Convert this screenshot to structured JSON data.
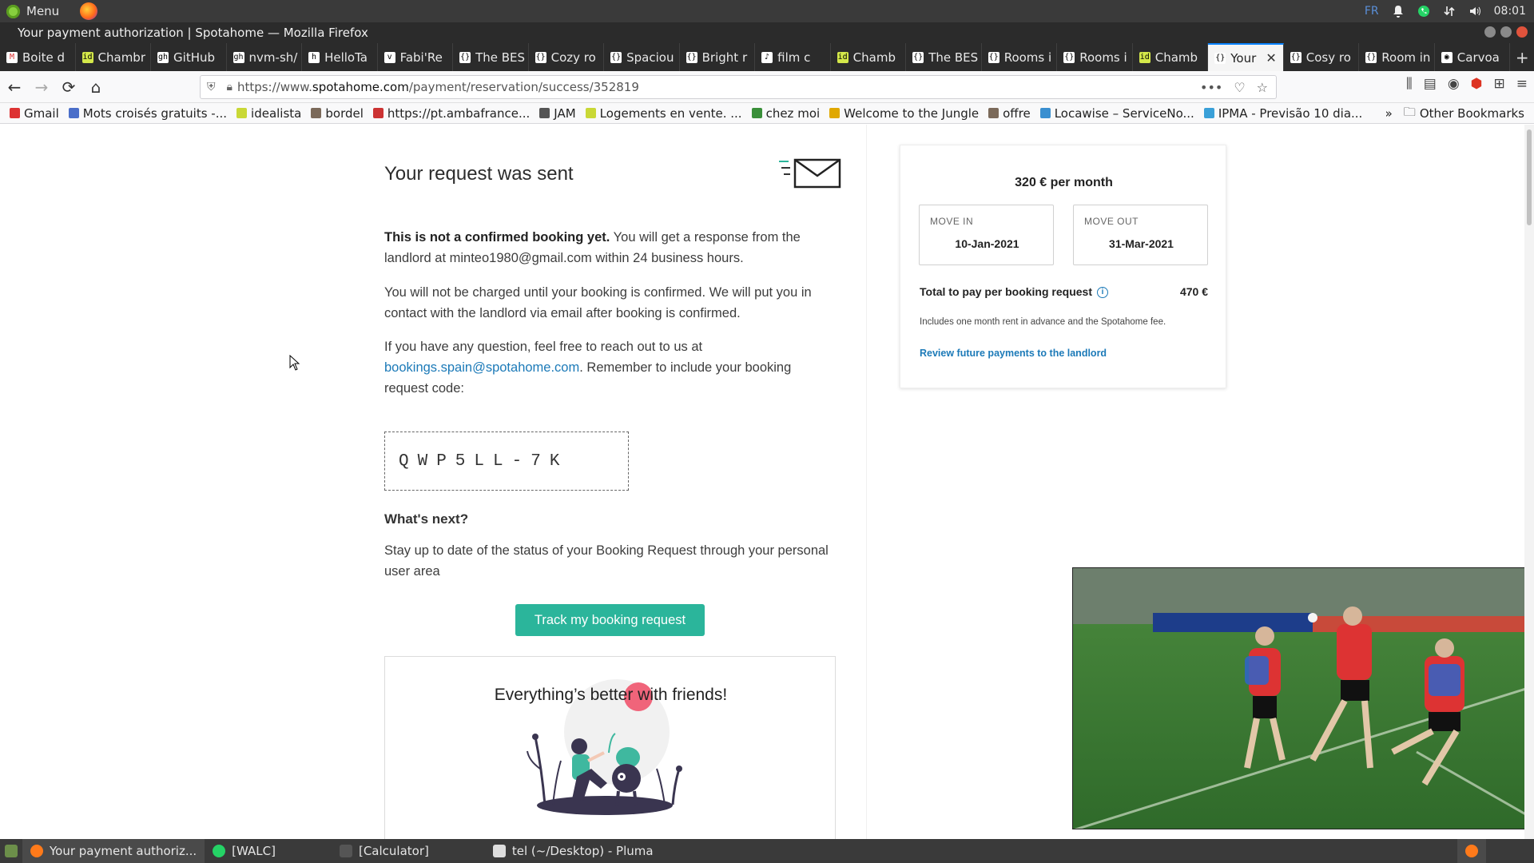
{
  "panel": {
    "menu_label": "Menu",
    "lang": "FR",
    "time": "08:01"
  },
  "window": {
    "title": "Your payment authorization | Spotahome — Mozilla Firefox"
  },
  "tabs": [
    {
      "label": "Boite d",
      "fav": "M"
    },
    {
      "label": "Chambr",
      "fav": "id"
    },
    {
      "label": "GitHub",
      "fav": "gh"
    },
    {
      "label": "nvm-sh/",
      "fav": "gh"
    },
    {
      "label": "HelloTa",
      "fav": "h"
    },
    {
      "label": "Fabi'Re",
      "fav": "v"
    },
    {
      "label": "The BES",
      "fav": "{}"
    },
    {
      "label": "Cozy ro",
      "fav": "{}"
    },
    {
      "label": "Spaciou",
      "fav": "{}"
    },
    {
      "label": "Bright r",
      "fav": "{}"
    },
    {
      "label": "film c",
      "fav": "♪"
    },
    {
      "label": "Chamb",
      "fav": "id"
    },
    {
      "label": "The BES",
      "fav": "{}"
    },
    {
      "label": "Rooms i",
      "fav": "{}"
    },
    {
      "label": "Rooms i",
      "fav": "{}"
    },
    {
      "label": "Chamb",
      "fav": "id"
    },
    {
      "label": "Your",
      "fav": "{}"
    },
    {
      "label": "Cosy ro",
      "fav": "{}"
    },
    {
      "label": "Room in",
      "fav": "{}"
    },
    {
      "label": "Carvoa",
      "fav": "◉"
    }
  ],
  "url": {
    "prefix": "https://www.",
    "host": "spotahome.com",
    "path": "/payment/reservation/success/352819"
  },
  "bookmarks": [
    "Gmail",
    "Mots croisés gratuits -...",
    "idealista",
    "bordel",
    "https://pt.ambafrance...",
    "JAM",
    "Logements en vente. ...",
    "chez moi",
    "Welcome to the Jungle",
    "offre",
    "Locawise – ServiceNo...",
    "IPMA - Previsão 10 dia..."
  ],
  "bookmarks_other": "Other Bookmarks",
  "page": {
    "heading": "Your request was sent",
    "p1_bold": "This is not a confirmed booking yet.",
    "p1_rest": " You will get a response from the landlord at minteo1980@gmail.com within 24 business hours.",
    "p2": "You will not be charged until your booking is confirmed. We will put you in contact with the landlord via email after booking is confirmed.",
    "p3_start": "If you have any question, feel free to reach out to us at ",
    "p3_link": "bookings.spain@spotahome.com",
    "p3_end": ". Remember to include your booking request code:",
    "code": "QWP5LL-7K",
    "whats_next": "What's next?",
    "p4": "Stay up to date of the status of your Booking Request through your personal user area",
    "track_button": "Track my booking request",
    "friends_title": "Everything’s better with friends!"
  },
  "summary": {
    "price": "320 € per month",
    "move_in_label": "MOVE IN",
    "move_in": "10-Jan-2021",
    "move_out_label": "MOVE OUT",
    "move_out": "31-Mar-2021",
    "total_label": "Total to pay per booking request",
    "total_value": "470 €",
    "includes": "Includes one month rent in advance and the Spotahome fee.",
    "review_link": "Review future payments to the landlord"
  },
  "taskbar": [
    {
      "label": "Your payment authoriz..."
    },
    {
      "label": "[WALC]"
    },
    {
      "label": "[Calculator]"
    },
    {
      "label": "tel (~/Desktop) - Pluma"
    }
  ],
  "colors": {
    "accent": "#2bb59b",
    "link": "#1c7ab8",
    "firefox_blue": "#0a84ff"
  }
}
